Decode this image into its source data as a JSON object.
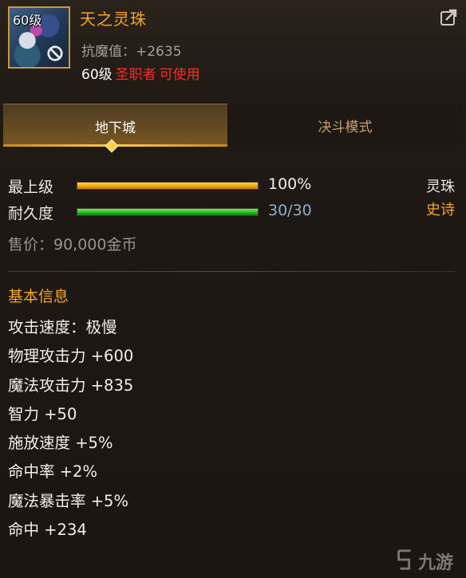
{
  "item": {
    "level_badge": "60级",
    "name": "天之灵珠",
    "magic_resist": "抗魔值：+2635",
    "req_level": "60级",
    "req_class": "圣职者",
    "req_usable": "可使用"
  },
  "tabs": [
    {
      "label": "地下城",
      "active": true
    },
    {
      "label": "决斗模式",
      "active": false
    }
  ],
  "bars": {
    "quality": {
      "label": "最上级",
      "value_text": "100%",
      "fill_fraction": 1.0
    },
    "durability": {
      "label": "耐久度",
      "value_text": "30/30",
      "fill_fraction": 1.0
    }
  },
  "item_type": "灵珠",
  "item_rarity": "史诗",
  "price": "售价：90,000金币",
  "section_title": "基本信息",
  "attributes": [
    "攻击速度：极慢",
    "物理攻击力 +600",
    "魔法攻击力 +835",
    "智力 +50",
    "施放速度 +5%",
    "命中率 +2%",
    "魔法暴击率 +5%",
    "命中 +234"
  ],
  "watermark": "九游",
  "colors": {
    "item_name": "#f5a623",
    "requirement_warning": "#ff2a2a",
    "quality_bar": "#f0a010",
    "durability_bar": "#20b820",
    "rarity_epic": "#f5a623"
  },
  "icons": {
    "forbid": "forbid-icon",
    "share": "share-icon",
    "tab_marker": "diamond-icon",
    "logo": "watermark-logo-icon"
  }
}
